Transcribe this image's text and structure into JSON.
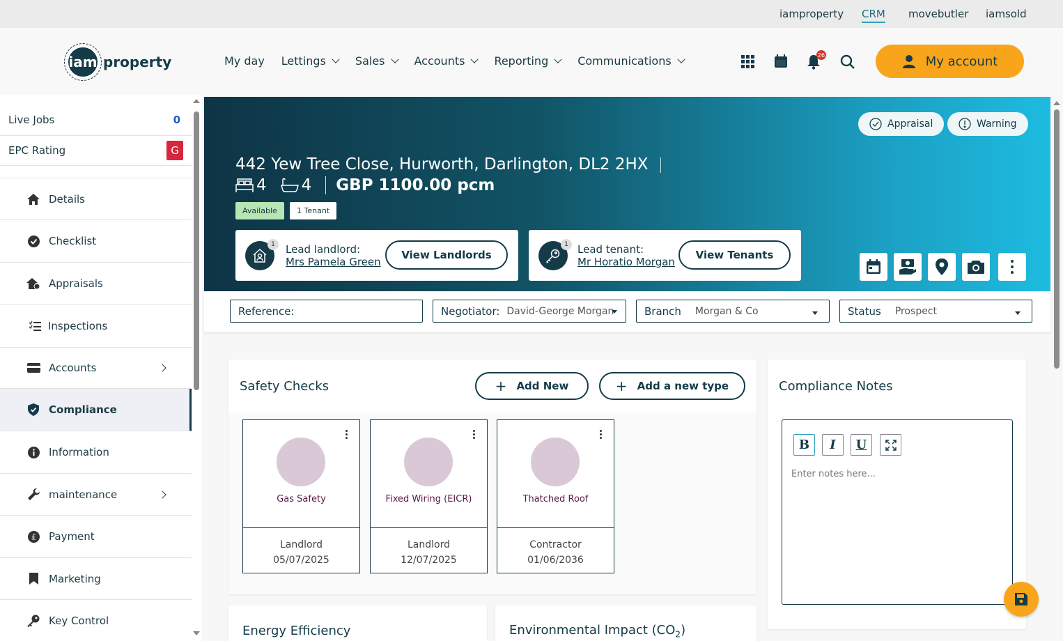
{
  "top_links": [
    "iamproperty",
    "CRM",
    "movebutler",
    "iamsold"
  ],
  "logo": {
    "mark": "iam",
    "text": "property"
  },
  "nav": [
    "My day",
    "Lettings",
    "Sales",
    "Accounts",
    "Reporting",
    "Communications"
  ],
  "header_icons": {
    "apps": "grid-icon",
    "calendar": "calendar-icon",
    "bell": "bell-icon",
    "bell_count": "26",
    "search": "search-icon"
  },
  "my_account": "My account",
  "sidebar": {
    "live_jobs_label": "Live Jobs",
    "live_jobs_count": "0",
    "epc_label": "EPC Rating",
    "epc_value": "G",
    "items": [
      {
        "label": "Details",
        "icon": "home-icon"
      },
      {
        "label": "Checklist",
        "icon": "check-circle-icon"
      },
      {
        "label": "Appraisals",
        "icon": "home-valuation-icon"
      },
      {
        "label": "Inspections",
        "icon": "list-check-icon"
      },
      {
        "label": "Accounts",
        "icon": "card-icon"
      },
      {
        "label": "Compliance",
        "icon": "shield-icon"
      },
      {
        "label": "Information",
        "icon": "info-icon"
      },
      {
        "label": "maintenance",
        "icon": "wrench-icon"
      },
      {
        "label": "Payment",
        "icon": "pound-icon"
      },
      {
        "label": "Marketing",
        "icon": "bookmark-icon"
      },
      {
        "label": "Key Control",
        "icon": "key-icon"
      }
    ]
  },
  "property": {
    "address": "442 Yew Tree Close, Hurworth, Darlington, DL2 2HX",
    "bedrooms": "4",
    "bathrooms": "4",
    "price": "GBP 1100.00 pcm",
    "tags": [
      "Available",
      "1 Tenant"
    ],
    "pills": [
      "Appraisal",
      "Warning"
    ]
  },
  "landlord": {
    "count": "1",
    "label": "Lead landlord:",
    "name": "Mrs Pamela Green",
    "button": "View Landlords"
  },
  "tenant": {
    "count": "1",
    "label": "Lead tenant:",
    "name": "Mr Horatio Morgan",
    "button": "View Tenants"
  },
  "filters": {
    "reference_label": "Reference:",
    "negotiator_label": "Negotiator:",
    "negotiator_value": "David-George Morgan",
    "branch_label": "Branch",
    "branch_value": "Morgan & Co",
    "status_label": "Status",
    "status_value": "Prospect"
  },
  "safety": {
    "title": "Safety Checks",
    "add_new": "Add New",
    "add_type": "Add a new type",
    "checks": [
      {
        "name": "Gas Safety",
        "role": "Landlord",
        "date": "05/07/2025"
      },
      {
        "name": "Fixed Wiring (EICR)",
        "role": "Landlord",
        "date": "12/07/2025"
      },
      {
        "name": "Thatched Roof",
        "role": "Contractor",
        "date": "01/06/2036"
      }
    ]
  },
  "notes": {
    "title": "Compliance Notes",
    "bold": "B",
    "italic": "I",
    "underline": "U",
    "placeholder": "Enter notes here..."
  },
  "energy_title": "Energy Efficiency",
  "environment_title": "Environmental Impact (CO",
  "environment_sub": "2",
  "environment_close": ")",
  "colors": {
    "accent": "#f9a51b",
    "primary": "#143b47",
    "epc": "#d7263d",
    "available_tag": "#b9e4b3"
  }
}
